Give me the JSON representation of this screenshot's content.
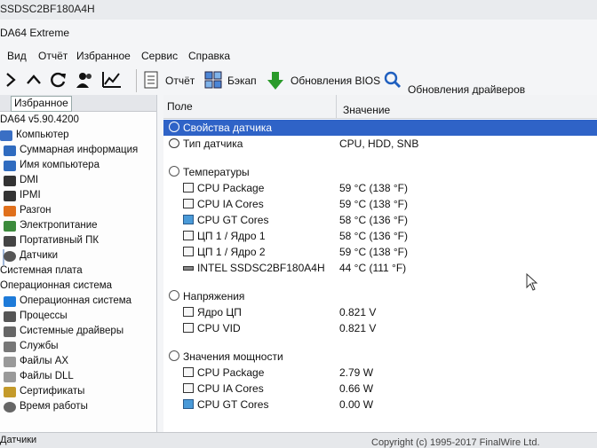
{
  "window": {
    "titlebar_text": "SSDSC2BF180A4H",
    "app_title": "DA64 Extreme"
  },
  "menu": [
    "Вид",
    "Отчёт",
    "Избранное",
    "Сервис",
    "Справка"
  ],
  "toolbar": {
    "icons": [
      "back-icon",
      "up-icon",
      "refresh-icon",
      "users-icon",
      "chart-icon"
    ],
    "buttons": [
      {
        "label": "Отчёт",
        "icon": "report-icon"
      },
      {
        "label": "Бэкап",
        "icon": "backup-icon"
      },
      {
        "label": "Обновления BIOS",
        "icon": "download-arrow-icon"
      },
      {
        "label": "Обновления драйверов",
        "icon": "magnifier-icon"
      }
    ]
  },
  "sidebar": {
    "tab": "Избранное",
    "items": [
      {
        "label": "DA64 v5.90.4200",
        "icon": "",
        "level": 0
      },
      {
        "label": "Компьютер",
        "icon": "computer-icon",
        "level": 0
      },
      {
        "label": "Суммарная информация",
        "icon": "monitor-icon",
        "level": 1
      },
      {
        "label": "Имя компьютера",
        "icon": "monitor-icon",
        "level": 1
      },
      {
        "label": "DMI",
        "icon": "dmi-icon",
        "level": 1
      },
      {
        "label": "IPMI",
        "icon": "ipmi-icon",
        "level": 1
      },
      {
        "label": "Разгон",
        "icon": "flame-icon",
        "level": 1
      },
      {
        "label": "Электропитание",
        "icon": "power-icon",
        "level": 1
      },
      {
        "label": "Портативный ПК",
        "icon": "laptop-icon",
        "level": 1
      },
      {
        "label": "Датчики",
        "icon": "sensor-icon",
        "level": 1,
        "selected": true
      },
      {
        "label": "Системная плата",
        "icon": "",
        "level": 0
      },
      {
        "label": "Операционная система",
        "icon": "",
        "level": 0
      },
      {
        "label": "Операционная система",
        "icon": "windows-icon",
        "level": 1
      },
      {
        "label": "Процессы",
        "icon": "process-icon",
        "level": 1
      },
      {
        "label": "Системные драйверы",
        "icon": "driver-icon",
        "level": 1
      },
      {
        "label": "Службы",
        "icon": "gear-icon",
        "level": 1
      },
      {
        "label": "Файлы AX",
        "icon": "file-icon",
        "level": 1
      },
      {
        "label": "Файлы DLL",
        "icon": "file-icon",
        "level": 1
      },
      {
        "label": "Сертификаты",
        "icon": "certificate-icon",
        "level": 1
      },
      {
        "label": "Время работы",
        "icon": "clock-icon",
        "level": 1
      }
    ]
  },
  "table": {
    "headers": [
      "Поле",
      "Значение"
    ],
    "rows": [
      {
        "type": "group",
        "field": "Свойства датчика",
        "value": "",
        "selected": true,
        "icon": "sensor-props-icon"
      },
      {
        "type": "item",
        "field": "Тип датчика",
        "value": "CPU, HDD, SNB",
        "icon": "sensor-icon"
      },
      {
        "type": "spacer"
      },
      {
        "type": "group",
        "field": "Температуры",
        "value": "",
        "icon": "thermometer-icon"
      },
      {
        "type": "item",
        "field": "CPU Package",
        "value": "59 °C  (138 °F)",
        "icon": "chip-icon"
      },
      {
        "type": "item",
        "field": "CPU IA Cores",
        "value": "59 °C  (138 °F)",
        "icon": "chip-icon"
      },
      {
        "type": "item",
        "field": "CPU GT Cores",
        "value": "58 °C  (136 °F)",
        "icon": "gpu-icon"
      },
      {
        "type": "item",
        "field": "ЦП 1 / Ядро 1",
        "value": "58 °C  (136 °F)",
        "icon": "chip-icon"
      },
      {
        "type": "item",
        "field": "ЦП 1 / Ядро 2",
        "value": "59 °C  (138 °F)",
        "icon": "chip-icon"
      },
      {
        "type": "item",
        "field": "INTEL SSDSC2BF180A4H",
        "value": "44 °C  (111 °F)",
        "icon": "disk-icon"
      },
      {
        "type": "spacer"
      },
      {
        "type": "group",
        "field": "Напряжения",
        "value": "",
        "icon": "voltage-icon"
      },
      {
        "type": "item",
        "field": "Ядро ЦП",
        "value": "0.821 V",
        "icon": "chip-icon"
      },
      {
        "type": "item",
        "field": "CPU VID",
        "value": "0.821 V",
        "icon": "chip-icon"
      },
      {
        "type": "spacer"
      },
      {
        "type": "group",
        "field": "Значения мощности",
        "value": "",
        "icon": "power-icon"
      },
      {
        "type": "item",
        "field": "CPU Package",
        "value": "2.79 W",
        "icon": "chip-icon"
      },
      {
        "type": "item",
        "field": "CPU IA Cores",
        "value": "0.66 W",
        "icon": "chip-icon"
      },
      {
        "type": "item",
        "field": "CPU GT Cores",
        "value": "0.00 W",
        "icon": "gpu-icon"
      }
    ]
  },
  "status": {
    "left": "Датчики",
    "right": "Copyright (c) 1995-2017 FinalWire Ltd."
  },
  "colors": {
    "selection": "#2f63c7",
    "bios_arrow": "#2a9a2a",
    "toolbar_icon": "#1f5fbf"
  }
}
